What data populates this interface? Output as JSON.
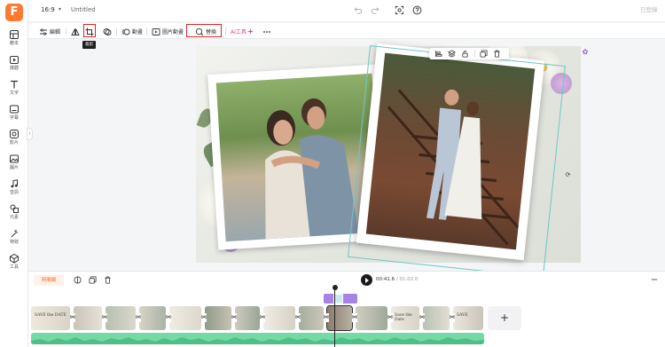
{
  "app": {
    "logo": "F",
    "title": "Untitled",
    "login": "已登錄"
  },
  "topbar": {
    "ratio": "16:9",
    "ratio_caret": "▾"
  },
  "sidebar": {
    "items": [
      {
        "icon": "template-icon",
        "label": "範本"
      },
      {
        "icon": "upload-icon",
        "label": "媒體"
      },
      {
        "icon": "text-icon",
        "label": "文字"
      },
      {
        "icon": "subtitle-icon",
        "label": "字幕"
      },
      {
        "icon": "photo-icon",
        "label": "影片"
      },
      {
        "icon": "image-icon",
        "label": "圖片"
      },
      {
        "icon": "music-icon",
        "label": "音訊"
      },
      {
        "icon": "elements-icon",
        "label": "元素"
      },
      {
        "icon": "effects-icon",
        "label": "特效"
      },
      {
        "icon": "tools-icon",
        "label": "工具"
      }
    ]
  },
  "toolbar": {
    "edit": "編輯",
    "crop_tooltip": "裁剪",
    "animate": "動畫",
    "in_animate": "圖片動畫",
    "replace": "替換",
    "ai_tools": "AI工具"
  },
  "timeline": {
    "tab": "時間線",
    "current_time": "00:41.6",
    "total_time": "/ 01:02.0",
    "clip_titles": [
      "SAVE the DATE",
      "",
      "",
      "",
      "",
      "",
      "",
      "",
      "Save the Date",
      "",
      "",
      "",
      "",
      "",
      "SAVE"
    ]
  },
  "colors": {
    "brand": "#ff7a2f",
    "highlight": "#d4262c",
    "selection": "#6cc7c9",
    "audio": "#75d9a7",
    "overlay": "#a883e6"
  }
}
